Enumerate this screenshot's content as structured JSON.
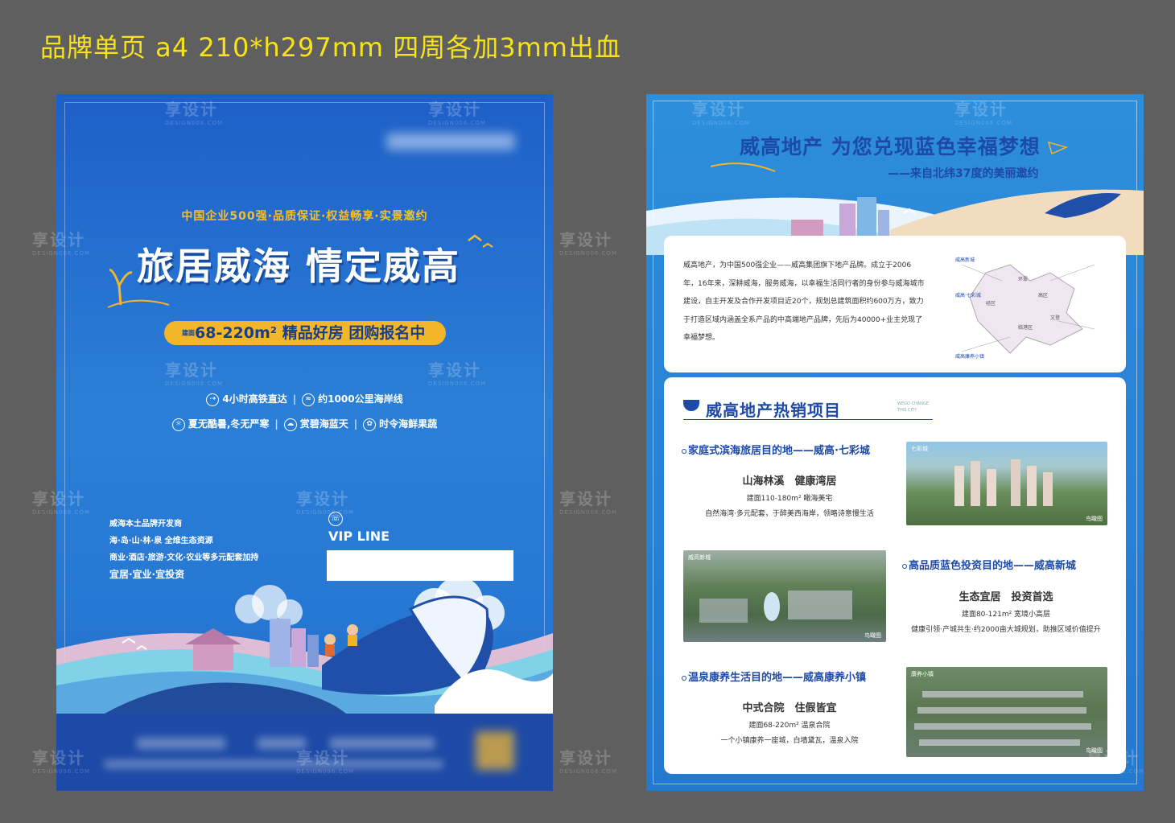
{
  "spec_title": "品牌单页 a4 210*h297mm 四周各加3mm出血",
  "watermark": {
    "cn": "享设计",
    "en": "DESIGN006.COM"
  },
  "left_page": {
    "tagline": "中国企业500强·品质保证·权益畅享·实景邀约",
    "headline": "旅居威海 情定威高",
    "pill": {
      "prefix": "建面",
      "area": "68-220m²",
      "text": " 精品好房 团购报名中"
    },
    "features_row1": [
      "4小时高铁直达",
      "约1000公里海岸线"
    ],
    "features_row2": [
      "夏无酷暑,冬无严寒",
      "赏碧海蓝天",
      "时令海鲜果蔬"
    ],
    "info_list": [
      "威海本土品牌开发商",
      "海·岛·山·林·泉 全维生态资源",
      "商业·酒店·旅游·文化·农业等多元配套加持",
      "宜居·宜业·宜投资"
    ],
    "vip_label": "VIP LINE"
  },
  "right_page": {
    "headline": "威高地产 为您兑现蓝色幸福梦想",
    "subheadline": "——来自北纬37度的美丽邀约",
    "intro": "威高地产，为中国500强企业——威高集团旗下地产品牌。成立于2006年，16年来，深耕威海，服务威海，以幸福生活同行者的身份参与威海城市建设，自主开发及合作开发项目近20个，规划总建筑面积约600万方，致力于打造区域内涵盖全系产品的中高端地产品牌，先后为40000+业主兑现了幸福梦想。",
    "map_labels": [
      "威高新城",
      "威高·七彩城",
      "威高康养小镇",
      "环翠",
      "高区",
      "经区",
      "临港区",
      "文登"
    ],
    "section_title": "威高地产热销项目",
    "section_en": [
      "WEGO CHANGE",
      "THIS CITY"
    ],
    "projects": [
      {
        "title": "家庭式滨海旅居目的地——威高·七彩城",
        "slogan": "山海林溪　健康湾居",
        "area": "建面110-180m² 瞰海美宅",
        "desc": "自然海湾·多元配套，于醉美西海岸，领略诗意慢生活",
        "photo_tag": "鸟瞰图",
        "photo_label": "七彩城"
      },
      {
        "title": "高品质蓝色投资目的地——威高新城",
        "slogan": "生态宜居　投资首选",
        "area": "建面80-121m² 宽境小高层",
        "desc": "健康引领·产城共生·约2000亩大城规划，助推区域价值提升",
        "photo_tag": "鸟瞰图",
        "photo_label": "威高新城"
      },
      {
        "title": "温泉康养生活目的地——威高康养小镇",
        "slogan": "中式合院　住假皆宜",
        "area": "建面68-220m² 温泉合院",
        "desc": "一个小镇康养一座城，白墙黛瓦，温泉入院",
        "photo_tag": "鸟瞰图",
        "photo_label": "康养小镇"
      }
    ]
  }
}
